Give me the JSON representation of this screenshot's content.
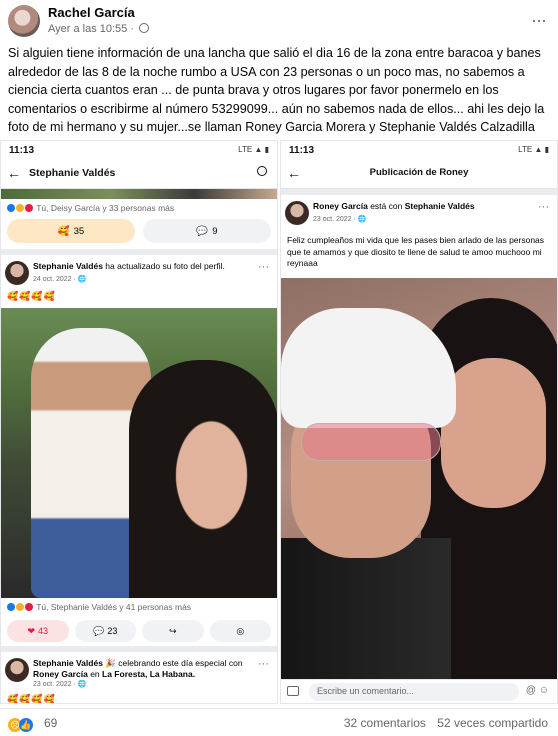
{
  "post": {
    "author": "Rachel García",
    "time": "Ayer a las 10:55",
    "separator": "·",
    "more": "···",
    "text": "Si alguien tiene información de una lancha que salió el dia 16 de la zona entre baracoa y banes alrededor de las 8 de la noche  rumbo a USA con 23 personas o un poco mas, no sabemos a ciencia cierta cuantos eran ... de punta brava y otros lugares por favor ponermelo en los comentarios o escribirme al número 53299099... aún no sabemos nada de ellos... ahi les dejo la foto de mi hermano y su mujer...se llaman Roney Garcia Morera y Stephanie Valdés Calzadilla"
  },
  "left_shot": {
    "time": "11:13",
    "status_icons": "LTE ▲ ▮",
    "title": "Stephanie Valdés",
    "reactions_line": "Tú, Deisy García y 33 personas más",
    "react_count": "35",
    "comment_count": "9",
    "post_author": "Stephanie Valdés",
    "post_action": "ha actualizado su foto del perfil.",
    "post_date": "24 oct. 2022 · ",
    "emojis": "🥰🥰🥰🥰",
    "reactions_line2": "Tú, Stephanie Valdés y 41 personas más",
    "love_count": "43",
    "comment_count2": "23",
    "post2_author": "Stephanie Valdés",
    "post2_action": "celebrando este día especial con",
    "post2_with": "Roney García",
    "post2_place_pre": "en",
    "post2_place": "La Foresta, La Habana.",
    "post2_date": "23 oct. 2022 · ",
    "emojis2": "🥰🥰🥰🥰"
  },
  "right_shot": {
    "time": "11:13",
    "status_icons": "LTE ▲ ▮",
    "title": "Publicación de Roney",
    "post_author": "Roney García",
    "post_with_pre": "está con",
    "post_with": "Stephanie Valdés",
    "post_date": "23 oct. 2022 · ",
    "post_text": "Feliz cumpleaños mi vida que les pases bien arlado de las personas que te amamos y que diosito te llene de salud te amoo muchooo  mi reynaaa",
    "comment_placeholder": "Escribe un comentario..."
  },
  "footer": {
    "reactions": "69",
    "comments": "32 comentarios",
    "shares": "52 veces compartido"
  }
}
